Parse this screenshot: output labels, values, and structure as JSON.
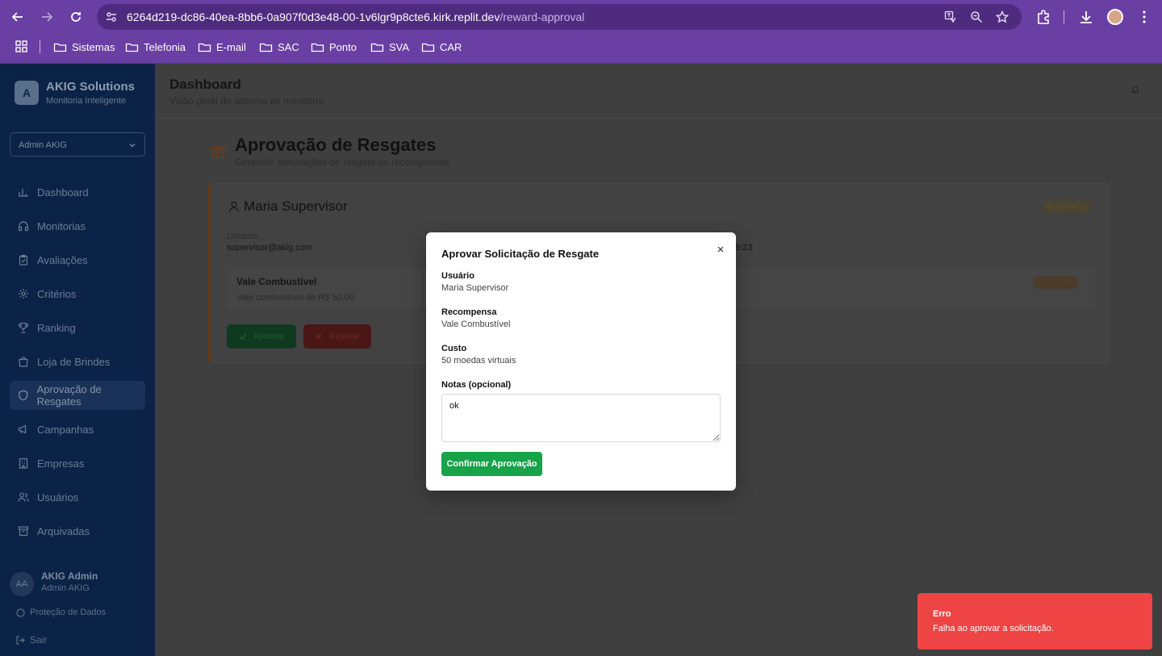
{
  "browser": {
    "url_host": "6264d219-dc86-40ea-8bb6-0a907f0d3e48-00-1v6lgr9p8cte6.kirk.replit.dev",
    "url_path": "/reward-approval",
    "bookmarks": [
      "Sistemas",
      "Telefonia",
      "E-mail",
      "SAC",
      "Ponto",
      "SVA",
      "CAR"
    ]
  },
  "sidebar": {
    "brand_initial": "A",
    "brand_name": "AKIG Solutions",
    "brand_tagline": "Monitoria Inteligente",
    "selected_user": "Admin AKIG",
    "items": [
      {
        "label": "Dashboard",
        "icon": "chart-icon"
      },
      {
        "label": "Monitorias",
        "icon": "headphones-icon"
      },
      {
        "label": "Avaliações",
        "icon": "clipboard-icon"
      },
      {
        "label": "Critérios",
        "icon": "gear-icon"
      },
      {
        "label": "Ranking",
        "icon": "trophy-icon"
      },
      {
        "label": "Loja de Brindes",
        "icon": "shopping-bag-icon"
      },
      {
        "label": "Aprovação de Resgates",
        "icon": "shield-icon"
      },
      {
        "label": "Campanhas",
        "icon": "megaphone-icon"
      },
      {
        "label": "Empresas",
        "icon": "building-icon"
      },
      {
        "label": "Usuários",
        "icon": "users-icon"
      },
      {
        "label": "Arquivadas",
        "icon": "archive-icon"
      }
    ],
    "active_item": "Aprovação de Resgates",
    "footer": {
      "avatar_initials": "AA",
      "user_name": "AKIG Admin",
      "user_role": "Admin AKIG",
      "privacy_label": "Proteção de Dados",
      "logout_label": "Sair"
    }
  },
  "header": {
    "title": "Dashboard",
    "subtitle": "Visão geral do sistema de monitoria"
  },
  "page": {
    "title": "Aprovação de Resgates",
    "subtitle": "Gerencie solicitações de resgate de recompensas"
  },
  "request_card": {
    "user_name": "Maria Supervisor",
    "status": "Pendente",
    "user_label": "Usuário",
    "user_email": "supervisor@akig.com",
    "time_fragment": "9:23",
    "reward_name": "Vale Combustível",
    "reward_description": "Vale combustível de R$ 50,00",
    "cost_badge": "50 moedas",
    "approve_label": "Aprovar",
    "reject_label": "Rejeitar"
  },
  "modal": {
    "title": "Aprovar Solicitação de Resgate",
    "user_label": "Usuário",
    "user_value": "Maria Supervisor",
    "reward_label": "Recompensa",
    "reward_value": "Vale Combustível",
    "cost_label": "Custo",
    "cost_value": "50 moedas virtuais",
    "notes_label": "Notas (opcional)",
    "notes_value": "ok",
    "confirm_label": "Confirmar Aprovação"
  },
  "toast": {
    "title": "Erro",
    "message": "Falha ao aprovar a solicitação."
  },
  "colors": {
    "browser_chrome": "#6a3fa3",
    "sidebar_bg": "#0b2347",
    "confirm_button": "#16a34a",
    "toast_error": "#ef4444"
  }
}
